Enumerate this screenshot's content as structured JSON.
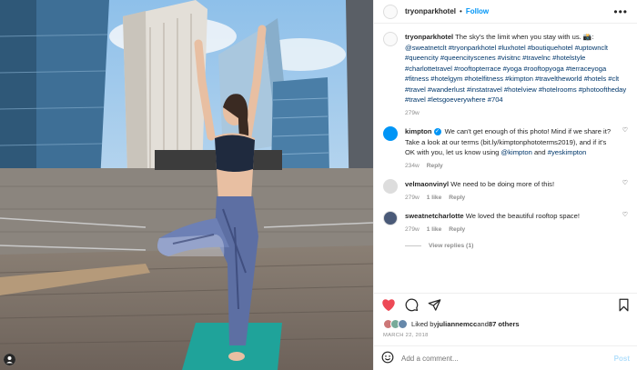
{
  "header": {
    "username": "tryonparkhotel",
    "follow_label": "Follow",
    "separator": "•",
    "more": "•••"
  },
  "caption": {
    "username": "tryonparkhotel",
    "text": "The sky's the limit when you stay with us. 📸:",
    "tags": "@sweatnetclt #tryonparkhotel #luxhotel #boutiquehotel #uptownclt #queencity #queencityscenes #visitnc #travelnc #hotelstyle #charlottetravel #rooftopterrace #yoga #rooftopyoga #terraceyoga #fitness #hotelgym #hotelfitness #kimpton #traveltheworld #hotels #clt #travel #wanderlust #instatravel #hotelview #hotelrooms #photooftheday #travel #letsgoeverywhere #704",
    "age": "279w"
  },
  "comments": [
    {
      "username": "kimpton",
      "verified": true,
      "text": "We can't get enough of this photo! Mind if we share it? Take a look at our terms (bit.ly/kimptonphototerms2019), and if it's OK with you, let us know using ",
      "tag1": "@kimpton",
      "and": " and ",
      "tag2": "#yeskimpton",
      "age": "234w",
      "likes": "",
      "reply": "Reply"
    },
    {
      "username": "velmaonvinyl",
      "text": "We need to be doing more of this!",
      "age": "279w",
      "likes": "1 like",
      "reply": "Reply"
    },
    {
      "username": "sweatnetcharlotte",
      "text": "We loved the beautiful rooftop space!",
      "age": "279w",
      "likes": "1 like",
      "reply": "Reply"
    }
  ],
  "view_replies": "View replies (1)",
  "likes": {
    "prefix": "Liked by ",
    "user": "juliannemcc",
    "mid": " and ",
    "count": "87 others"
  },
  "date": "MARCH 22, 2018",
  "add_comment": {
    "placeholder": "Add a comment...",
    "post_label": "Post"
  },
  "colors": {
    "accent": "#0095f6",
    "heart": "#ed4956",
    "sky": "#b9d7ee",
    "mat": "#1fa39a"
  }
}
